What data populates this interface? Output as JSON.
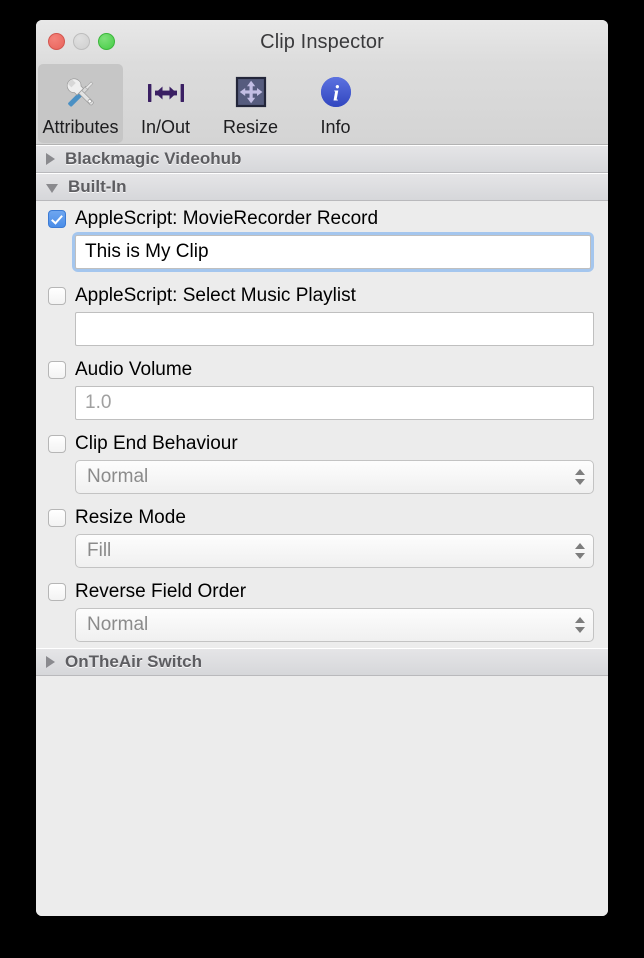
{
  "window": {
    "title": "Clip Inspector",
    "traffic_lights": [
      {
        "name": "close",
        "color": "#e8635b"
      },
      {
        "name": "minimize",
        "color": "#cfcfcf"
      },
      {
        "name": "zoom",
        "color": "#45cd45"
      }
    ]
  },
  "toolbar": {
    "items": [
      {
        "label": "Attributes",
        "icon": "tools-wrench-screwdriver-icon",
        "selected": true
      },
      {
        "label": "In/Out",
        "icon": "horizontal-arrow-icon",
        "selected": false
      },
      {
        "label": "Resize",
        "icon": "four-way-arrow-icon",
        "selected": false
      },
      {
        "label": "Info",
        "icon": "info-circle-icon",
        "selected": false
      }
    ]
  },
  "groups": [
    {
      "label": "Blackmagic Videohub",
      "expanded": false
    },
    {
      "label": "Built-In",
      "expanded": true
    },
    {
      "label": "OnTheAir Switch",
      "expanded": false
    }
  ],
  "rows": [
    {
      "label": "AppleScript: MovieRecorder Record",
      "checked": true,
      "control": "text",
      "value": "This is My Clip",
      "placeholder": "",
      "focused": true,
      "dim": false
    },
    {
      "label": "AppleScript: Select Music Playlist",
      "checked": false,
      "control": "text",
      "value": "",
      "placeholder": "",
      "focused": false,
      "dim": false
    },
    {
      "label": "Audio Volume",
      "checked": false,
      "control": "text",
      "value": "1.0",
      "placeholder": "1.0",
      "focused": false,
      "dim": true
    },
    {
      "label": "Clip End Behaviour",
      "checked": false,
      "control": "combo",
      "value": "Normal",
      "focused": false,
      "dim": true
    },
    {
      "label": "Resize Mode",
      "checked": false,
      "control": "combo",
      "value": "Fill",
      "focused": false,
      "dim": true
    },
    {
      "label": "Reverse Field Order",
      "checked": false,
      "control": "combo",
      "value": "Normal",
      "focused": false,
      "dim": true
    }
  ],
  "colors": {
    "window_bg": "#ececec",
    "accent_checkbox": "#4a8de8",
    "focus_ring": "#a4c6ee",
    "group_header_text": "#5d5d61",
    "info_icon": "#3f5bd4",
    "inout_icon": "#3a1f63",
    "resize_icon": "#565c7e"
  }
}
